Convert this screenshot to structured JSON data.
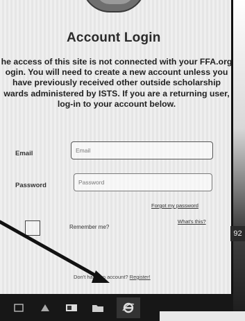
{
  "page": {
    "title": "Account Login",
    "intro_lines": [
      "he access of this site is not connected with your FFA.org",
      "ogin. You will need to create a new account unless you",
      "have previously received other outside scholarship",
      "wards administered by ISTS. If you are a returning user,",
      "log-in to your account below."
    ]
  },
  "form": {
    "email_label": "Email",
    "email_placeholder": "Email",
    "password_label": "Password",
    "password_placeholder": "Password",
    "forgot_link": "Forgot my password",
    "remember_label": "Remember me?",
    "whats_this_link": "What's this?",
    "register_prefix": "Don't have an account?",
    "register_link": "Register!"
  },
  "taskbar": {
    "icons": [
      "window-icon",
      "app-icon",
      "outlook-icon",
      "folder-icon",
      "internet-explorer-icon"
    ]
  },
  "side_chip": "92",
  "colors": {
    "screen": "#efefef",
    "taskbar": "#171717",
    "arrow": "#111111"
  }
}
